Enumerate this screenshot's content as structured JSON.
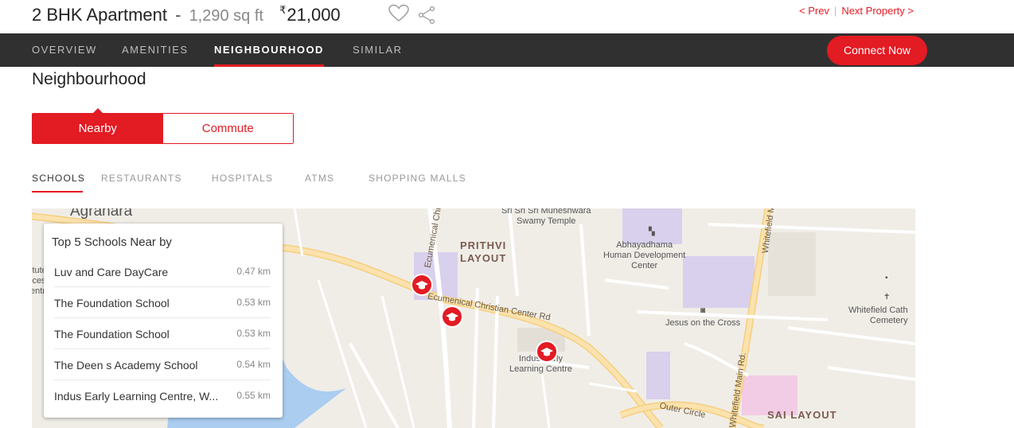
{
  "header": {
    "title": "2 BHK Apartment",
    "separator": "-",
    "area": "1,290 sq ft",
    "currency_symbol": "₹",
    "price": "21,000",
    "prev_label": "< Prev",
    "divider": "|",
    "next_label": "Next Property >"
  },
  "nav": {
    "tabs": [
      {
        "label": "OVERVIEW"
      },
      {
        "label": "AMENITIES"
      },
      {
        "label": "NEIGHBOURHOOD"
      },
      {
        "label": "SIMILAR"
      }
    ],
    "active_tab": "NEIGHBOURHOOD",
    "connect_label": "Connect Now"
  },
  "neighbourhood": {
    "title": "Neighbourhood",
    "toggle": [
      {
        "label": "Nearby"
      },
      {
        "label": "Commute"
      }
    ],
    "active_toggle": "Nearby",
    "categories": [
      {
        "label": "SCHOOLS"
      },
      {
        "label": "RESTAURANTS"
      },
      {
        "label": "HOSPITALS"
      },
      {
        "label": "ATMS"
      },
      {
        "label": "SHOPPING MALLS"
      }
    ],
    "active_category": "SCHOOLS"
  },
  "panel": {
    "title": "Top 5 Schools Near by",
    "schools": [
      {
        "name": "Luv and Care DayCare",
        "distance": "0.47 km"
      },
      {
        "name": "The Foundation School",
        "distance": "0.53 km"
      },
      {
        "name": "The Foundation School",
        "distance": "0.53 km"
      },
      {
        "name": "The Deen s Academy School",
        "distance": "0.54 km"
      },
      {
        "name": "Indus Early Learning Centre, W...",
        "distance": "0.55 km"
      }
    ]
  },
  "map": {
    "labels": {
      "agrahara": "Agrahara",
      "temple": "Sri Sri Sri Muneshwara\nSwamy Temple",
      "prithvi": "PRITHVI\nLAYOUT",
      "abhayadhama": "Abhayadhama\nHuman Development\nCenter",
      "jesus": "Jesus on the Cross",
      "cathedral": "Whitefield Cath\nCemetery",
      "indus": "Indus Early\nLearning Centre",
      "sai": "SAI LAYOUT",
      "road_ecc": "Ecumenical Christian Center Rd",
      "road_ecc_v": "Ecumenical Chr",
      "road_outer": "Outer Circle",
      "road_main": "Whitefield Main Rd.",
      "road_wf": "Whitefield M",
      "left_partial": "itute\nices and\nentre"
    }
  },
  "colors": {
    "accent": "#e31b23",
    "navbar": "#303030",
    "map_bg": "#f0ede7",
    "road": "#f6cf7d",
    "water": "#aacdf0",
    "purple_zone": "#d8d0ec",
    "pink_zone": "#f2cbe4"
  },
  "icons": {
    "heart": "heart-outline-icon",
    "share": "share-icon",
    "school_pin": "graduation-cap-icon"
  }
}
